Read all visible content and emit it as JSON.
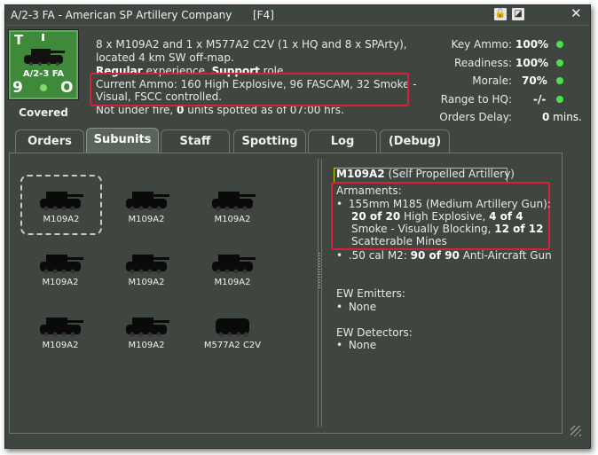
{
  "window": {
    "title": "A/2-3 FA - American SP Artillery Company",
    "hotkey": "[F4]"
  },
  "counter": {
    "top_letter": "T",
    "name": "A/2-3 FA",
    "left_num": "9",
    "right_letter": "O",
    "status": "Covered"
  },
  "description": {
    "line1": "8 x M109A2 and 1 x M577A2 C2V (1 x HQ and 8 x SPArty),",
    "line2": "located 4 km SW off-map.",
    "line3_b1": "Regular",
    "line3_t1": " experience. ",
    "line3_b2": "Support",
    "line3_t2": " role.",
    "line4": "Current Ammo: 160 High Explosive, 96 FASCAM, 32 Smoke -",
    "line5": "Visual, FSCC controlled.",
    "line6_t1": "Not under fire, ",
    "line6_b1": "0",
    "line6_t2": " units spotted as of 07:00 hrs."
  },
  "stats": [
    {
      "label": "Key Ammo:",
      "value": "100%",
      "dot": true
    },
    {
      "label": "Readiness:",
      "value": "100%",
      "dot": true
    },
    {
      "label": "Morale:",
      "value": "70%",
      "dot": true
    },
    {
      "label": "Range to HQ:",
      "value": "-/-",
      "dot": true
    },
    {
      "label": "Orders Delay:",
      "value": "0",
      "unit": " mins.",
      "dot": false
    }
  ],
  "tabs": [
    "Orders",
    "Subunits",
    "Staff",
    "Spotting",
    "Log",
    "(Debug)"
  ],
  "active_tab": "Subunits",
  "subunits": [
    "M109A2",
    "M109A2",
    "M109A2",
    "M109A2",
    "M109A2",
    "M109A2",
    "M109A2",
    "M109A2",
    "M577A2 C2V"
  ],
  "detail": {
    "name": "M109A2",
    "type": "(Self Propelled Artillery)",
    "armaments_label": "Armaments:",
    "arm1_l1": "155mm M185 (Medium Artillery Gun):",
    "arm1_l2_b1": "20 of 20",
    "arm1_l2_t1": " High Explosive, ",
    "arm1_l2_b2": "4 of 4",
    "arm1_l3_t1": "Smoke - Visually Blocking, ",
    "arm1_l3_b1": "12 of 12",
    "arm1_l4": "Scatterable Mines",
    "arm2_t1": ".50 cal M2: ",
    "arm2_b1": "90 of 90",
    "arm2_t2": " Anti-Aircraft Gun",
    "ew_emitters_label": "EW Emitters:",
    "ew_emitters_value": "None",
    "ew_detectors_label": "EW Detectors:",
    "ew_detectors_value": "None"
  },
  "colors": {
    "window_bg": "#3f4640",
    "highlight": "#d6203c",
    "status_ok": "#4ee04a",
    "unit_green": "#3f8a3a"
  }
}
